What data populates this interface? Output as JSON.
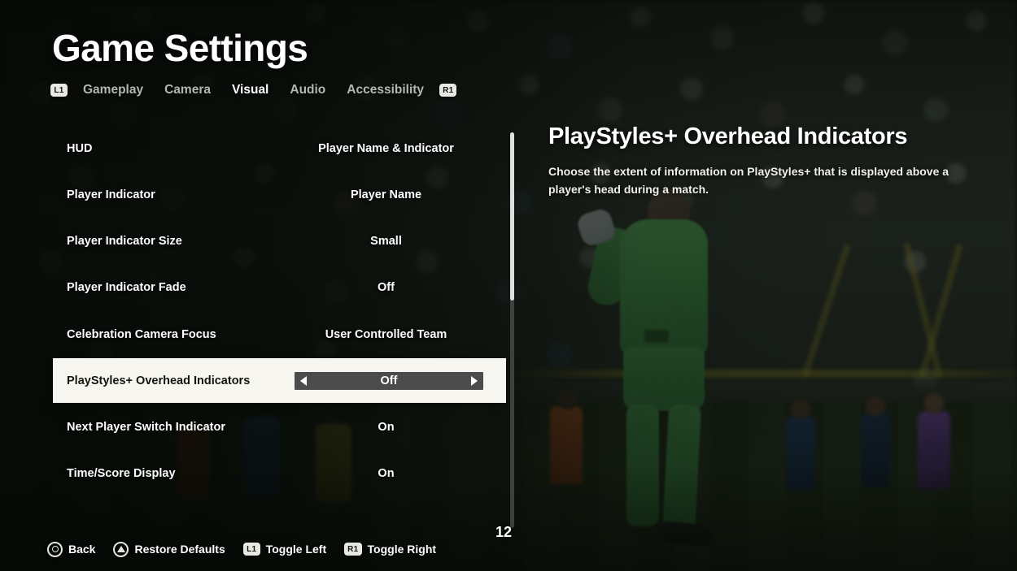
{
  "header": {
    "title": "Game Settings",
    "bumper_left": "L1",
    "bumper_right": "R1",
    "tabs": [
      {
        "label": "Gameplay",
        "active": false
      },
      {
        "label": "Camera",
        "active": false
      },
      {
        "label": "Visual",
        "active": true
      },
      {
        "label": "Audio",
        "active": false
      },
      {
        "label": "Accessibility",
        "active": false
      }
    ]
  },
  "settings": {
    "rows": [
      {
        "label": "HUD",
        "value": "Player Name & Indicator",
        "selected": false
      },
      {
        "label": "Player Indicator",
        "value": "Player Name",
        "selected": false
      },
      {
        "label": "Player Indicator Size",
        "value": "Small",
        "selected": false
      },
      {
        "label": "Player Indicator Fade",
        "value": "Off",
        "selected": false
      },
      {
        "label": "Celebration Camera Focus",
        "value": "User Controlled Team",
        "selected": false
      },
      {
        "label": "PlayStyles+ Overhead Indicators",
        "value": "Off",
        "selected": true
      },
      {
        "label": "Next Player Switch Indicator",
        "value": "On",
        "selected": false
      },
      {
        "label": "Time/Score Display",
        "value": "On",
        "selected": false
      }
    ],
    "scroll": {
      "thumb_top_pct": 0,
      "thumb_height_pct": 42
    }
  },
  "detail": {
    "title": "PlayStyles+ Overhead Indicators",
    "description": "Choose the extent of information on PlayStyles+ that is displayed above a player's head during a match."
  },
  "footer": {
    "page_counter": "12",
    "prompts": [
      {
        "icon": "circle-button-icon",
        "glyph": "circle",
        "label": "Back"
      },
      {
        "icon": "triangle-button-icon",
        "glyph": "triangle",
        "label": "Restore Defaults"
      },
      {
        "icon": "l1-bumper-icon",
        "glyph": "badge",
        "badge": "L1",
        "label": "Toggle Left"
      },
      {
        "icon": "r1-bumper-icon",
        "glyph": "badge",
        "badge": "R1",
        "label": "Toggle Right"
      }
    ]
  },
  "theme": {
    "accent_selected_bg": "#f7f6f1",
    "selected_text": "#15150f",
    "spinner_bg": "#4b4b4b",
    "text_primary": "#ffffff",
    "text_muted": "#b4b7b2",
    "jersey_green": "#4fae57"
  }
}
